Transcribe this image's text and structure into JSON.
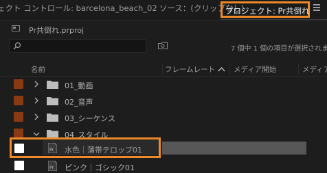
{
  "tabs": {
    "effect_controls": "ェクト コントロール: barcelona_beach_02",
    "source": "ソース：(クリップなし)",
    "project": "プロジェクト: Pr共倒れ"
  },
  "project": {
    "file_name": "Pr共倒れ.prproj"
  },
  "search": {
    "placeholder": ""
  },
  "status": {
    "selection_text": "7 個中 1 個の項目が選択されま"
  },
  "columns": {
    "name": "名前",
    "framerate": "フレームレート",
    "media_start": "メディア開始",
    "media_end": "メディア"
  },
  "items": [
    {
      "label": "01_動画",
      "type": "folder",
      "expanded": false,
      "color": "#8a3a12"
    },
    {
      "label": "02_音声",
      "type": "folder",
      "expanded": false,
      "color": "#8a3a12"
    },
    {
      "label": "03_シーケンス",
      "type": "folder",
      "expanded": false,
      "color": "#8a3a12"
    },
    {
      "label": "04_スタイル",
      "type": "folder",
      "expanded": true,
      "color": "#8a3a12"
    },
    {
      "label": "水色｜蒲帯テロップ01",
      "type": "clip",
      "selected": true,
      "color": "#ffffff"
    },
    {
      "label": "ピンク｜ゴシック01",
      "type": "clip",
      "selected": false,
      "color": "#ffffff"
    }
  ],
  "colors": {
    "accent": "#ef8a2a",
    "label_brown": "#8a3a12",
    "label_white": "#ffffff"
  }
}
